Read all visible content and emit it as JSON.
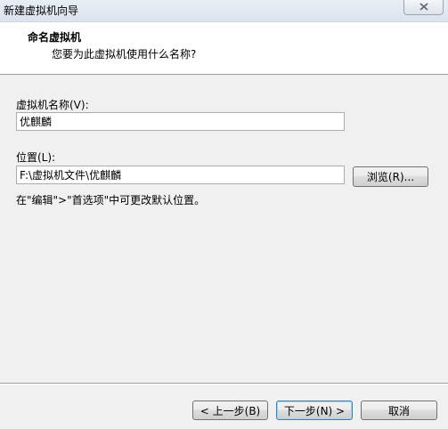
{
  "window": {
    "title": "新建虚拟机向导",
    "close_icon": "close-icon"
  },
  "header": {
    "title": "命名虚拟机",
    "subtitle": "您要为此虚拟机使用什么名称?"
  },
  "form": {
    "name_label": "虚拟机名称(V):",
    "name_value": "优麒麟",
    "location_label": "位置(L):",
    "location_value": "F:\\虚拟机文件\\优麒麟",
    "browse_label": "浏览(R)...",
    "hint": "在\"编辑\">\"首选项\"中可更改默认位置。"
  },
  "footer": {
    "back_label": "< 上一步(B)",
    "next_label": "下一步(N) >",
    "cancel_label": "取消"
  }
}
